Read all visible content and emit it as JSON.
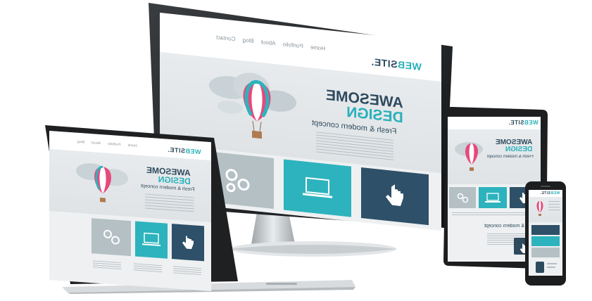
{
  "brand": {
    "logo_a": "WEB",
    "logo_b": "SITE.",
    "accent": "#29b0bb",
    "navy": "#2e4a5e",
    "tile_grey": "#b4c0c4",
    "tile_teal": "#2db3bd",
    "tile_navy": "#2e5068"
  },
  "nav": {
    "home": "Home",
    "portfolio": "Portfolio",
    "about": "About",
    "blog": "Blog",
    "contact": "Contact"
  },
  "hero": {
    "line1": "AWESOME",
    "line2": "DESIGN",
    "tagline": "Fresh & modern concept"
  },
  "section": {
    "title": "Fresh & modern concept"
  },
  "tiles": {
    "grey_icon": "gears-icon",
    "teal_icon": "laptop-icon",
    "navy_icon": "touch-hand-icon"
  },
  "illustration": {
    "icon": "hot-air-balloon-icon"
  }
}
